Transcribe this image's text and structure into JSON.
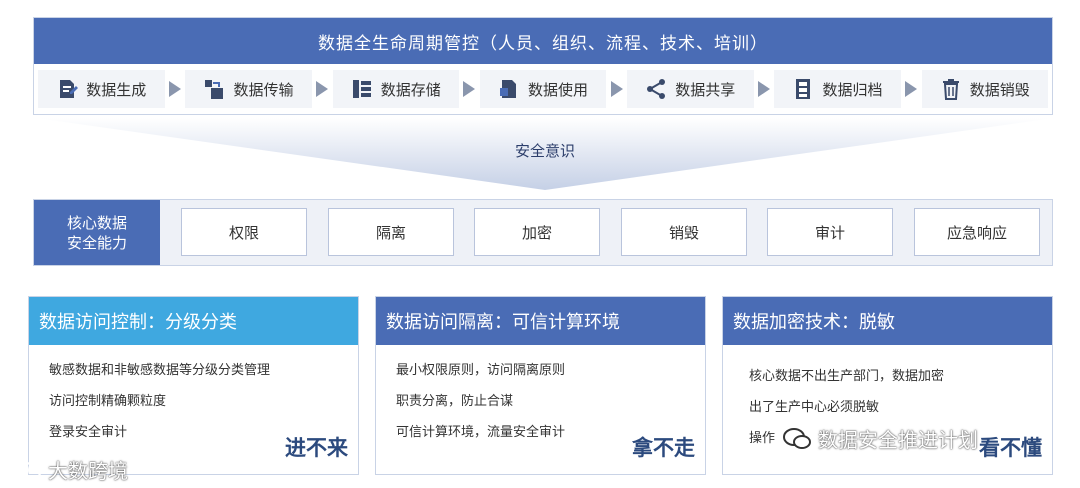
{
  "lifecycle": {
    "title": "数据全生命周期管控（人员、组织、流程、技术、培训）",
    "steps": [
      {
        "label": "数据生成",
        "icon": "document-edit-icon"
      },
      {
        "label": "数据传输",
        "icon": "transfer-icon"
      },
      {
        "label": "数据存储",
        "icon": "database-stack-icon"
      },
      {
        "label": "数据使用",
        "icon": "document-use-icon"
      },
      {
        "label": "数据共享",
        "icon": "share-icon"
      },
      {
        "label": "数据归档",
        "icon": "archive-cabinet-icon"
      },
      {
        "label": "数据销毁",
        "icon": "trash-icon"
      }
    ]
  },
  "funnel_label": "安全意识",
  "core": {
    "label_line1": "核心数据",
    "label_line2": "安全能力",
    "capabilities": [
      "权限",
      "隔离",
      "加密",
      "销毁",
      "审计",
      "应急响应"
    ]
  },
  "cards": [
    {
      "title": "数据访问控制：分级分类",
      "color": "#3fa8e0",
      "items": [
        "敏感数据和非敏感数据等分级分类管理",
        "访问控制精确颗粒度",
        "登录安全审计"
      ],
      "motto": "进不来"
    },
    {
      "title": "数据访问隔离：可信计算环境",
      "color": "#4a6cb5",
      "items": [
        "最小权限原则，访问隔离原则",
        "职责分离，防止合谋",
        "可信计算环境，流量安全审计"
      ],
      "motto": "拿不走"
    },
    {
      "title": "数据加密技术：脱敏",
      "color": "#4a6cb5",
      "items": [
        "核心数据不出生产部门，数据加密",
        "出了生产中心必须脱敏",
        "操作"
      ],
      "motto": "看不懂"
    }
  ],
  "watermarks": {
    "left": "大数跨境",
    "right": "数据安全推进计划"
  },
  "colors": {
    "primary": "#4a6cb5",
    "accent": "#3fa8e0",
    "panel_bg": "#f2f4f8"
  }
}
